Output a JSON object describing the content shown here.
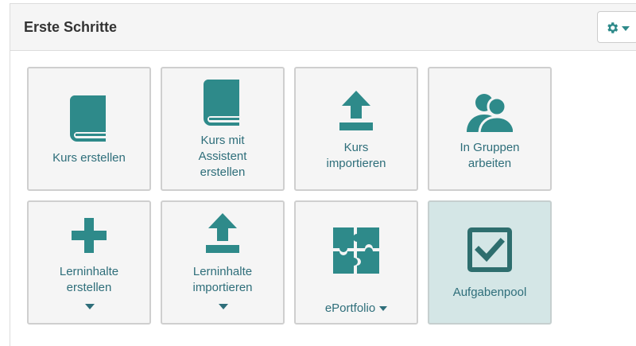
{
  "panel": {
    "title": "Erste Schritte",
    "settings_icon": "gear-icon"
  },
  "colors": {
    "accent": "#2e8a8a",
    "label": "#2e6e7a",
    "tile_bg": "#f5f5f5",
    "tile_active_bg": "#d4e6e6",
    "tile_border": "#cfcfcf"
  },
  "tiles": [
    {
      "label": "Kurs erstellen",
      "icon": "book-icon"
    },
    {
      "label": "Kurs mit\nAssistent\nerstellen",
      "icon": "book-icon"
    },
    {
      "label": "Kurs\nimportieren",
      "icon": "upload-icon"
    },
    {
      "label": "In Gruppen\narbeiten",
      "icon": "group-icon"
    },
    {
      "label": "Lerninhalte\nerstellen",
      "icon": "plus-icon",
      "has_dropdown": true
    },
    {
      "label": "Lerninhalte\nimportieren",
      "icon": "upload-icon",
      "has_dropdown": true
    },
    {
      "label": "ePortfolio",
      "icon": "puzzle-icon",
      "has_dropdown": true
    },
    {
      "label": "Aufgabenpool",
      "icon": "checkbox-icon",
      "active": true
    }
  ]
}
